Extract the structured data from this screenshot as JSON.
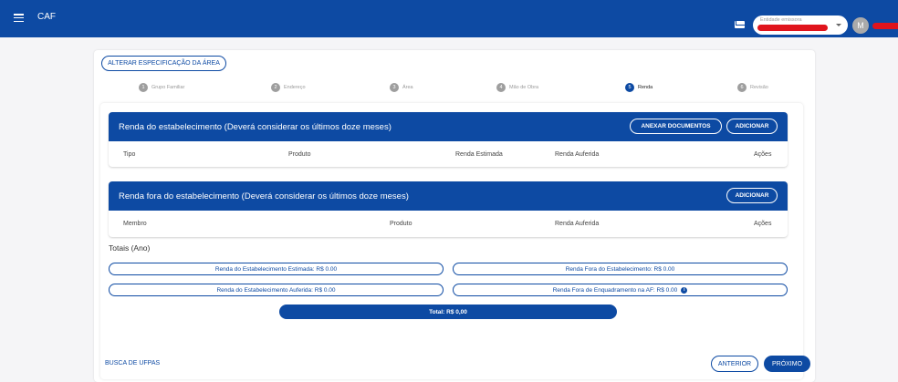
{
  "topbar": {
    "title": "CAF",
    "entity_select": {
      "placeholder": "Entidade emissora"
    },
    "avatar_initial": "M"
  },
  "header": {
    "change_area_label": "ALTERAR ESPECIFICAÇÃO DA ÁREA"
  },
  "stepper": [
    {
      "num": "1",
      "label": "Grupo Familiar"
    },
    {
      "num": "2",
      "label": "Endereço"
    },
    {
      "num": "3",
      "label": "Área"
    },
    {
      "num": "4",
      "label": "Mão de Obra"
    },
    {
      "num": "5",
      "label": "Renda",
      "active": true
    },
    {
      "num": "6",
      "label": "Revisão"
    }
  ],
  "section_establishment": {
    "title": "Renda do estabelecimento (Deverá considerar os últimos doze meses)",
    "attach_label": "ANEXAR DOCUMENTOS",
    "add_label": "ADICIONAR",
    "columns": [
      "Tipo",
      "Produto",
      "Renda Estimada",
      "Renda Auferida",
      "Ações"
    ]
  },
  "section_outside": {
    "title": "Renda fora do estabelecimento (Deverá considerar os últimos doze meses)",
    "add_label": "ADICIONAR",
    "columns": [
      "Membro",
      "Produto",
      "Renda Auferida",
      "Ações"
    ]
  },
  "totals": {
    "label": "Totais (Ano)",
    "est_estimated": "Renda do Estabelecimento Estimada: R$ 0.00",
    "outside": "Renda Fora do Estabelecimento: R$ 0.00",
    "est_received": "Renda do Estabelecimento Auferida: R$ 0.00",
    "outside_af": "Renda Fora de Enquadramento na AF: R$ 0.00",
    "total": "Total: R$ 0,00"
  },
  "footer": {
    "search_link": "BUSCA DE UFPAS",
    "prev_label": "ANTERIOR",
    "next_label": "PRÓXIMO"
  },
  "colors": {
    "primary": "#0d4aa3",
    "redaction": "#e0141c"
  }
}
